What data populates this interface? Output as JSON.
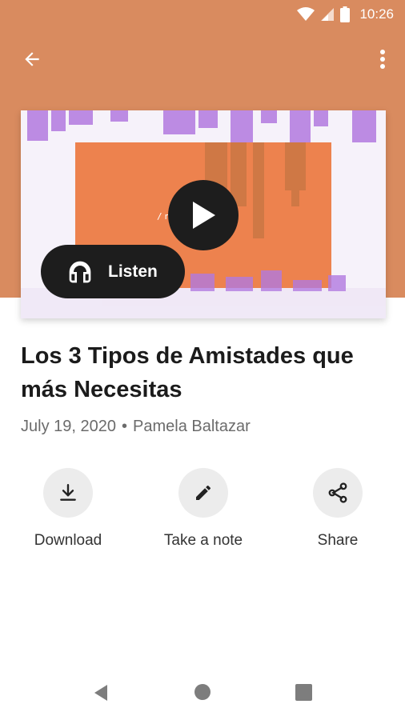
{
  "status_bar": {
    "time": "10:26"
  },
  "toolbar": {
    "back_icon": "arrow-back-icon",
    "more_icon": "more-vert-icon"
  },
  "cover": {
    "overlay_text": "/n               RNAL",
    "play_icon": "play-icon",
    "listen_label": "Listen",
    "listen_icon": "headphones-icon"
  },
  "article": {
    "title": "Los 3 Tipos de Amistades que más Necesitas",
    "date": "July 19, 2020",
    "separator": "•",
    "author": "Pamela Baltazar"
  },
  "actions": [
    {
      "label": "Download",
      "icon": "download-icon"
    },
    {
      "label": "Take a note",
      "icon": "pencil-icon"
    },
    {
      "label": "Share",
      "icon": "share-icon"
    }
  ],
  "colors": {
    "header": "#d98b5f",
    "button_dark": "#1d1d1d",
    "cover_orange": "#f08a3a",
    "cover_purple": "#b27ae0"
  }
}
